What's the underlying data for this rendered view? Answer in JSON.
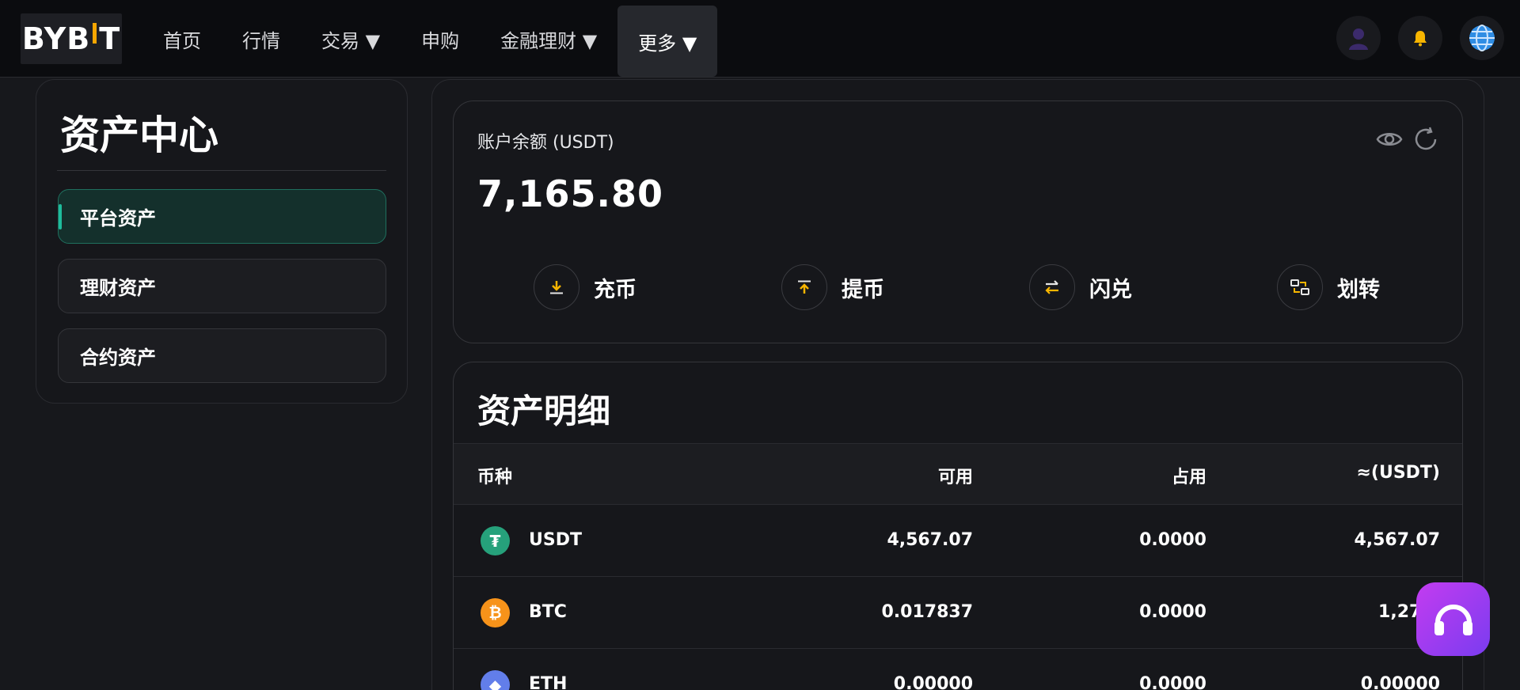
{
  "brand": {
    "logo_text_left": "BYB",
    "logo_text_right": "T",
    "accent": "#f7a600"
  },
  "nav": {
    "items": [
      {
        "label": "首页"
      },
      {
        "label": "行情"
      },
      {
        "label": "交易 ▼"
      },
      {
        "label": "申购"
      },
      {
        "label": "金融理财 ▼"
      },
      {
        "label": "更多 ▼"
      }
    ],
    "active": "更多 ▼",
    "icons": [
      "avatar-icon",
      "bell-icon",
      "globe-icon"
    ]
  },
  "sidebar": {
    "title": "资产中心",
    "items": [
      {
        "label": "平台资产",
        "active": true
      },
      {
        "label": "理财资产",
        "active": false
      },
      {
        "label": "合约资产",
        "active": false
      }
    ],
    "active_color": "#1ebc9c"
  },
  "balance": {
    "label": "账户余额 (USDT)",
    "value": "7,165.80",
    "icons": [
      "eye-icon",
      "refresh-icon"
    ],
    "actions": [
      {
        "label": "充币",
        "icon": "deposit-icon"
      },
      {
        "label": "提币",
        "icon": "withdraw-icon"
      },
      {
        "label": "闪兑",
        "icon": "swap-icon"
      },
      {
        "label": "划转",
        "icon": "transfer-icon"
      }
    ]
  },
  "details": {
    "title": "资产明细",
    "columns": [
      "币种",
      "可用",
      "占用",
      "≈(USDT)"
    ],
    "rows": [
      {
        "coin": "USDT",
        "available": "4,567.07",
        "used": "0.0000",
        "usdt": "4,567.07",
        "color": "#26a17b",
        "glyph": "₮"
      },
      {
        "coin": "BTC",
        "available": "0.017837",
        "used": "0.0000",
        "usdt": "1,270.",
        "color": "#f7931a",
        "glyph": "₿"
      },
      {
        "coin": "ETH",
        "available": "0.00000",
        "used": "0.0000",
        "usdt": "0.00000",
        "color": "#627eea",
        "glyph": "◆"
      }
    ]
  },
  "support": {
    "icon": "headset-icon"
  }
}
